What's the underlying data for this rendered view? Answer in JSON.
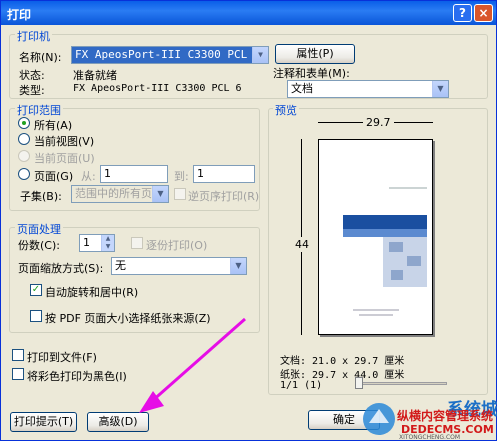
{
  "window": {
    "title": "打印",
    "help_icon": "?",
    "close_icon": "×"
  },
  "printer": {
    "group_label": "打印机",
    "name_label": "名称(N):",
    "name_value": "FX ApeosPort-III C3300 PCL 6",
    "properties_button": "属性(P)",
    "status_label": "状态:",
    "status_value": "准备就绪",
    "type_label": "类型:",
    "type_value": "FX ApeosPort-III C3300 PCL 6",
    "notes_label": "注释和表单(M):",
    "notes_value": "文档"
  },
  "range": {
    "group_label": "打印范围",
    "all": "所有(A)",
    "current_view": "当前视图(V)",
    "current_page": "当前页面(U)",
    "pages": "页面(G)",
    "from_label": "从:",
    "from_value": "1",
    "to_label": "到:",
    "to_value": "1",
    "subset_label": "子集(B):",
    "subset_value": "范围中的所有页面",
    "reverse": "逆页序打印(R)"
  },
  "handling": {
    "group_label": "页面处理",
    "copies_label": "份数(C):",
    "copies_value": "1",
    "collate": "逐份打印(O)",
    "scaling_label": "页面缩放方式(S):",
    "scaling_value": "无",
    "auto_rotate": "自动旋转和居中(R)",
    "choose_source": "按 PDF 页面大小选择纸张来源(Z)"
  },
  "options": {
    "print_to_file": "打印到文件(F)",
    "print_black": "将彩色打印为黑色(I)"
  },
  "preview": {
    "group_label": "预览",
    "width_dim": "29.7",
    "height_dim": "44",
    "doc_size": "文档: 21.0 x 29.7 厘米",
    "paper_size": "纸张: 29.7 x 44.0 厘米",
    "page_count": "1/1 (1)"
  },
  "buttons": {
    "tips": "打印提示(T)",
    "advanced": "高级(D)",
    "ok": "确定"
  },
  "watermark": {
    "line1": "系统城",
    "line2": "XITONGCHENG.COM",
    "line3": "纵横内容管理系统",
    "line4": "DEDECMS.COM"
  },
  "colors": {
    "title_bar": "#0a5fe8",
    "dialog_bg": "#ece9d8",
    "group_label": "#0046d5",
    "annotation_arrow": "#e60de6"
  }
}
